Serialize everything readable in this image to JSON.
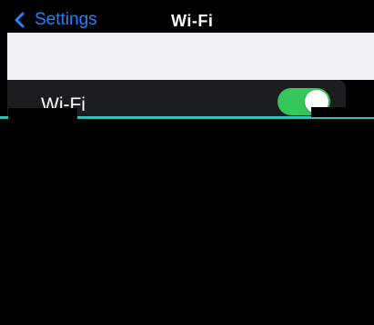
{
  "nav": {
    "back_label": "Settings",
    "title": "Wi-Fi"
  },
  "wifi": {
    "label": "Wi-Fi",
    "enabled": true
  },
  "colors": {
    "accent": "#1e84ff",
    "toggle_on": "#34c759",
    "separator": "#30c2b6",
    "cell_bg": "#1c1c1e",
    "group_bg": "#efeff4"
  },
  "icons": {
    "back": "chevron-left-icon"
  }
}
